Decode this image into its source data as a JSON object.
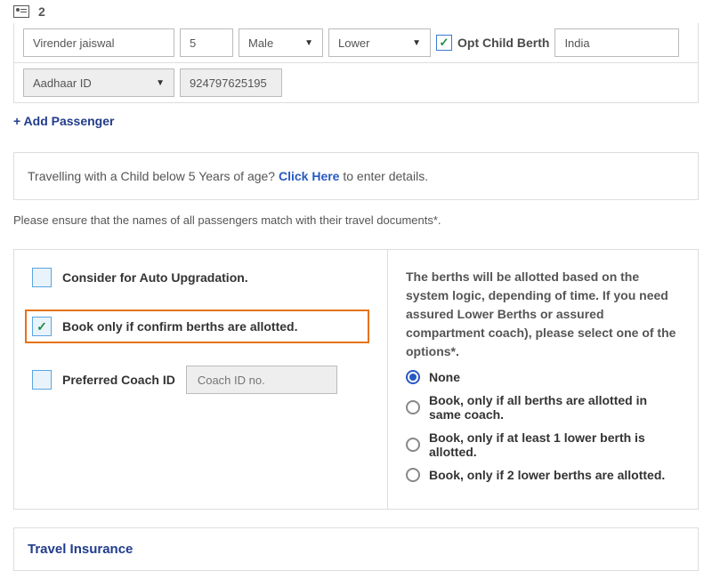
{
  "passenger": {
    "number": "2",
    "name": "Virender jaiswal",
    "age": "5",
    "gender": "Male",
    "berth": "Lower",
    "opt_child_label": "Opt Child Berth",
    "country": "India",
    "id_type": "Aadhaar ID",
    "id_number": "924797625195"
  },
  "add_passenger": "+ Add Passenger",
  "child_info": {
    "prefix": "Travelling with a Child below 5 Years of age? ",
    "link": "Click Here",
    "suffix": " to enter details."
  },
  "match_note": "Please ensure that the names of all passengers match with their travel documents*.",
  "left_options": {
    "auto_upgrade": "Consider for Auto Upgradation.",
    "confirm_berths": "Book only if confirm berths are allotted.",
    "preferred_coach": "Preferred Coach ID",
    "coach_placeholder": "Coach ID no."
  },
  "right_options": {
    "intro": "The berths will be allotted based on the system logic, depending of time. If you need assured Lower Berths or assured compartment coach), please select one of the options*.",
    "radios": [
      "None",
      "Book, only if all berths are allotted in same coach.",
      "Book, only if at least 1 lower berth is allotted.",
      "Book, only if 2 lower berths are allotted."
    ]
  },
  "insurance": {
    "title": "Travel Insurance"
  }
}
